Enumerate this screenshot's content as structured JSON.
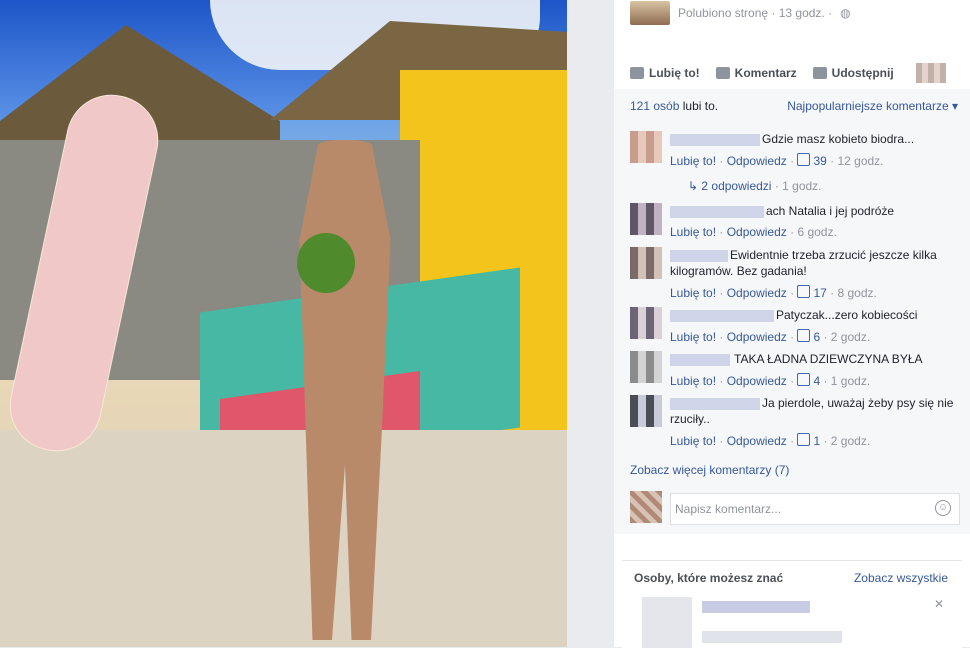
{
  "post": {
    "meta": "Polubiono stronę · 13 godz. ·",
    "actions": {
      "like": "Lubię to!",
      "comment": "Komentarz",
      "share": "Udostępnij"
    },
    "likes_count": "121 osób",
    "likes_suffix": "lubi to.",
    "sort_label": "Najpopularniejsze komentarze ▾"
  },
  "comments": [
    {
      "text": "Gdzie masz kobieto biodra...",
      "like": "Lubię to!",
      "reply": "Odpowiedz",
      "reactions": "39",
      "time": "12 godz."
    },
    {
      "text": "ach Natalia i jej podróże",
      "like": "Lubię to!",
      "reply": "Odpowiedz",
      "reactions": "",
      "time": "6 godz."
    },
    {
      "text": "Ewidentnie trzeba zrzucić jeszcze kilka kilogramów. Bez gadania!",
      "like": "Lubię to!",
      "reply": "Odpowiedz",
      "reactions": "17",
      "time": "8 godz."
    },
    {
      "text": "Patyczak...zero kobiecości",
      "like": "Lubię to!",
      "reply": "Odpowiedz",
      "reactions": "6",
      "time": "2 godz."
    },
    {
      "text": "TAKA ŁADNA DZIEWCZYNA BYŁA",
      "like": "Lubię to!",
      "reply": "Odpowiedz",
      "reactions": "4",
      "time": "1 godz."
    },
    {
      "text": "Ja pierdole, uważaj żeby psy się nie rzuciły..",
      "like": "Lubię to!",
      "reply": "Odpowiedz",
      "reactions": "1",
      "time": "2 godz."
    }
  ],
  "replies_link": "2 odpowiedzi",
  "replies_time": "· 1 godz.",
  "more_comments": "Zobacz więcej komentarzy (7)",
  "comment_input": {
    "placeholder": "Napisz komentarz..."
  },
  "pymk": {
    "title": "Osoby, które możesz znać",
    "see_all": "Zobacz wszystkie"
  },
  "icons": {
    "like": "thumbs-up-icon",
    "comment": "speech-bubble-icon",
    "share": "share-arrow-icon",
    "globe": "globe-icon",
    "smile": "emoji-icon",
    "close": "close-icon"
  },
  "colors": {
    "link": "#365899",
    "muted": "#90949c",
    "panel_bg": "#f6f7f9"
  }
}
